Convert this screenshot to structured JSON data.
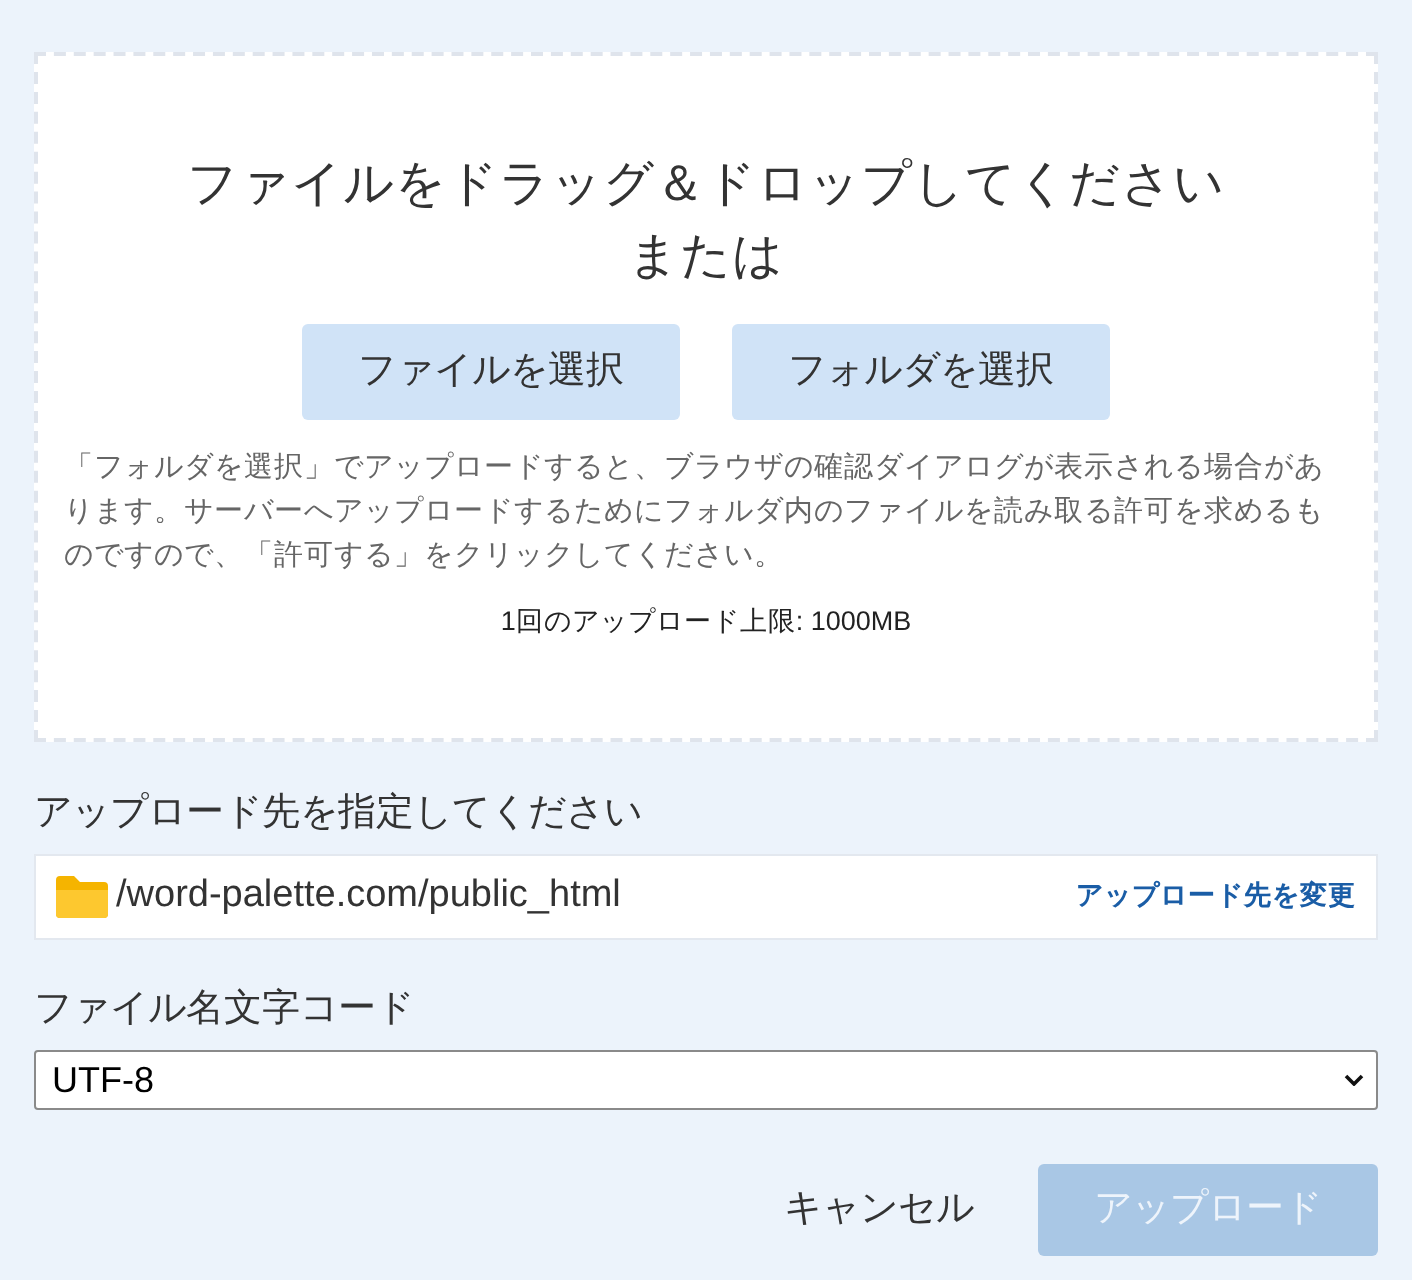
{
  "dropzone": {
    "title": "ファイルをドラッグ＆ドロップしてください",
    "or_text": "または",
    "buttons": [
      {
        "label": "ファイルを選択"
      },
      {
        "label": "フォルダを選択"
      }
    ],
    "note": "「フォルダを選択」でアップロードすると、ブラウザの確認ダイアログが表示される場合があります。サーバーへアップロードするためにフォルダ内のファイルを読み取る許可を求めるものですので、「許可する」をクリックしてください。",
    "limit": "1回のアップロード上限: 1000MB"
  },
  "destination": {
    "label": "アップロード先を指定してください",
    "path": "/word-palette.com/public_html",
    "change_link": "アップロード先を変更"
  },
  "encoding": {
    "label": "ファイル名文字コード",
    "value": "UTF-8"
  },
  "actions": [
    {
      "label": "キャンセル",
      "kind": "text",
      "disabled": false
    },
    {
      "label": "アップロード",
      "kind": "primary",
      "disabled": true
    }
  ]
}
